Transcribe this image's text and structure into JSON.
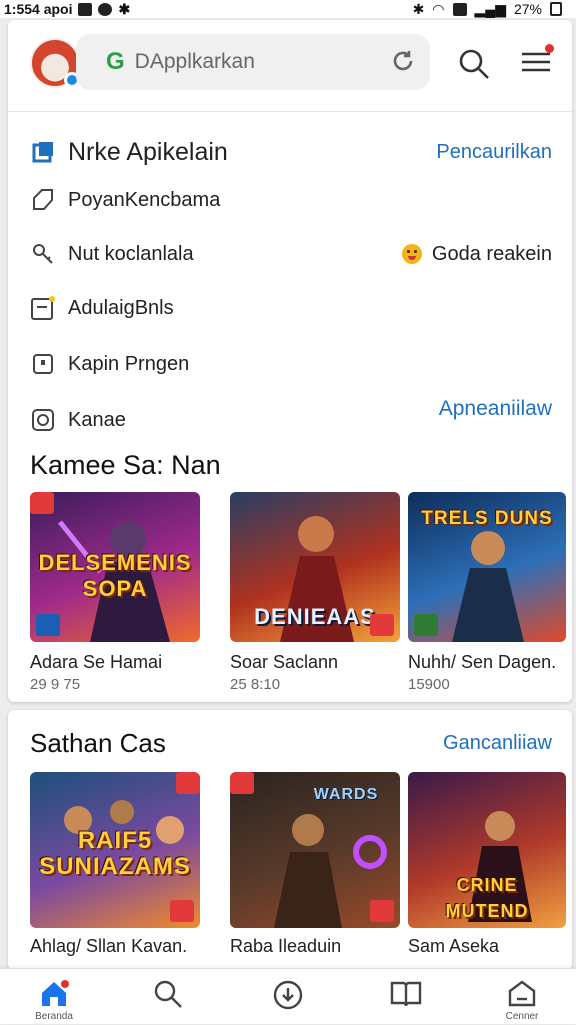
{
  "status_bar": {
    "time": "1:554 apoi",
    "battery": "27%"
  },
  "search": {
    "logo": "G",
    "placeholder": "DApplkarkan"
  },
  "menu": {
    "header": {
      "label": "Nrke Apikelain",
      "action": "Pencaurilkan",
      "icon": "app-icon"
    },
    "items": [
      {
        "label": "PoyanKencbama",
        "icon": "tag-icon"
      },
      {
        "label": "Nut koclanlala",
        "icon": "key-icon",
        "right": "Goda reakein",
        "right_icon": "emoji-icon"
      },
      {
        "label": "AdulaigBnls",
        "icon": "inbox-icon"
      },
      {
        "label": "Kapin Prngen",
        "icon": "gift-icon"
      },
      {
        "label": "Kanae",
        "icon": "settings-icon",
        "right": "Apneaniilaw"
      }
    ]
  },
  "section1": {
    "title": "Kamee Sa: Nan",
    "items": [
      {
        "name": "Adara Se Hamai",
        "sub": "29 9 75",
        "art": "DELSEMENIS SOPA",
        "colors": [
          "#3a1d5c",
          "#a02a8a",
          "#f06a2a"
        ]
      },
      {
        "name": "Soar Saclann",
        "sub": "25 8:10",
        "art": "DENIEAAS",
        "colors": [
          "#2a3e63",
          "#b0321f",
          "#f5a23a"
        ]
      },
      {
        "name": "Nuhh/ Sen Dagen.",
        "sub": "15900",
        "art": "TRELS DUNS",
        "colors": [
          "#0e2e5a",
          "#2d6fb8",
          "#e04a2a"
        ]
      }
    ]
  },
  "section2": {
    "title": "Sathan Cas",
    "action": "Gancanliiaw",
    "items": [
      {
        "name": "Ahlag/ Sllan Kavan.",
        "art": "RAIF5 SUNIAZAMS",
        "colors": [
          "#1d4f7a",
          "#7a4aa0",
          "#f08a2a"
        ]
      },
      {
        "name": "Raba Ileaduin",
        "art": "WARDS",
        "colors": [
          "#2a2420",
          "#5a3a2a",
          "#9a4a2a"
        ]
      },
      {
        "name": "Sam Aseka",
        "art": "CRINE MUTEND",
        "colors": [
          "#3a1a4a",
          "#b03a2a",
          "#f0a040"
        ]
      }
    ]
  },
  "nav": {
    "items": [
      {
        "label": "Beranda",
        "icon": "home-icon"
      },
      {
        "label": "",
        "icon": "search-icon"
      },
      {
        "label": "",
        "icon": "download-icon"
      },
      {
        "label": "",
        "icon": "book-icon"
      },
      {
        "label": "Cenner",
        "icon": "profile-icon"
      }
    ]
  },
  "colors": {
    "accent": "#1f6fbf",
    "notification": "#e2312c",
    "active_nav": "#1a73e8"
  }
}
